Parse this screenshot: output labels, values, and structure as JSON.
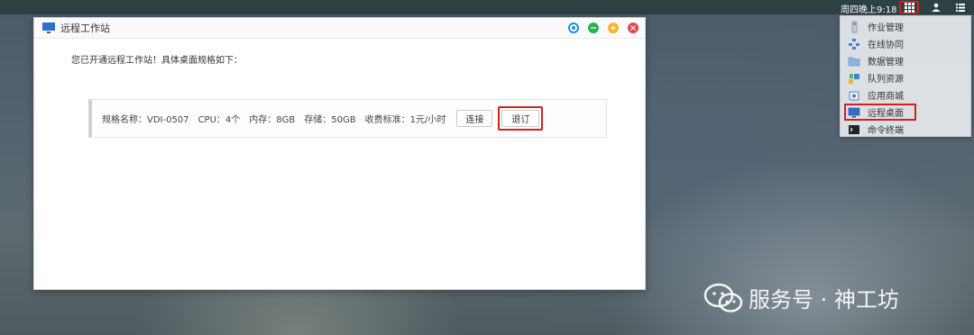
{
  "topbar": {
    "clock": "周四晚上9:18",
    "icons": [
      "apps-grid-icon",
      "user-icon",
      "list-icon"
    ]
  },
  "apps_menu": {
    "items": [
      {
        "label": "作业管理",
        "icon": "job-manage-icon"
      },
      {
        "label": "在线协同",
        "icon": "collaboration-icon"
      },
      {
        "label": "数据管理",
        "icon": "folder-icon"
      },
      {
        "label": "队列资源",
        "icon": "queue-icon"
      },
      {
        "label": "应用商城",
        "icon": "app-store-icon"
      },
      {
        "label": "远程桌面",
        "icon": "monitor-icon",
        "selected": true
      },
      {
        "label": "命令终端",
        "icon": "terminal-icon"
      }
    ]
  },
  "window": {
    "title": "远程工作站",
    "intro": "您已开通远程工作站！具体桌面规格如下：",
    "spec": {
      "name": "规格名称：VDI-0507",
      "cpu": "CPU：4个",
      "memory": "内存：8GB",
      "storage": "存储：50GB",
      "price": "收费标准：1元/小时"
    },
    "connect_label": "连接",
    "unsubscribe_label": "退订"
  },
  "watermark": {
    "text": "服务号 · 神工坊"
  },
  "colors": {
    "highlight": "#d42020",
    "info": "#1a8fe0",
    "min": "#2ab24e",
    "max": "#f5b42a",
    "close": "#e8454a"
  }
}
